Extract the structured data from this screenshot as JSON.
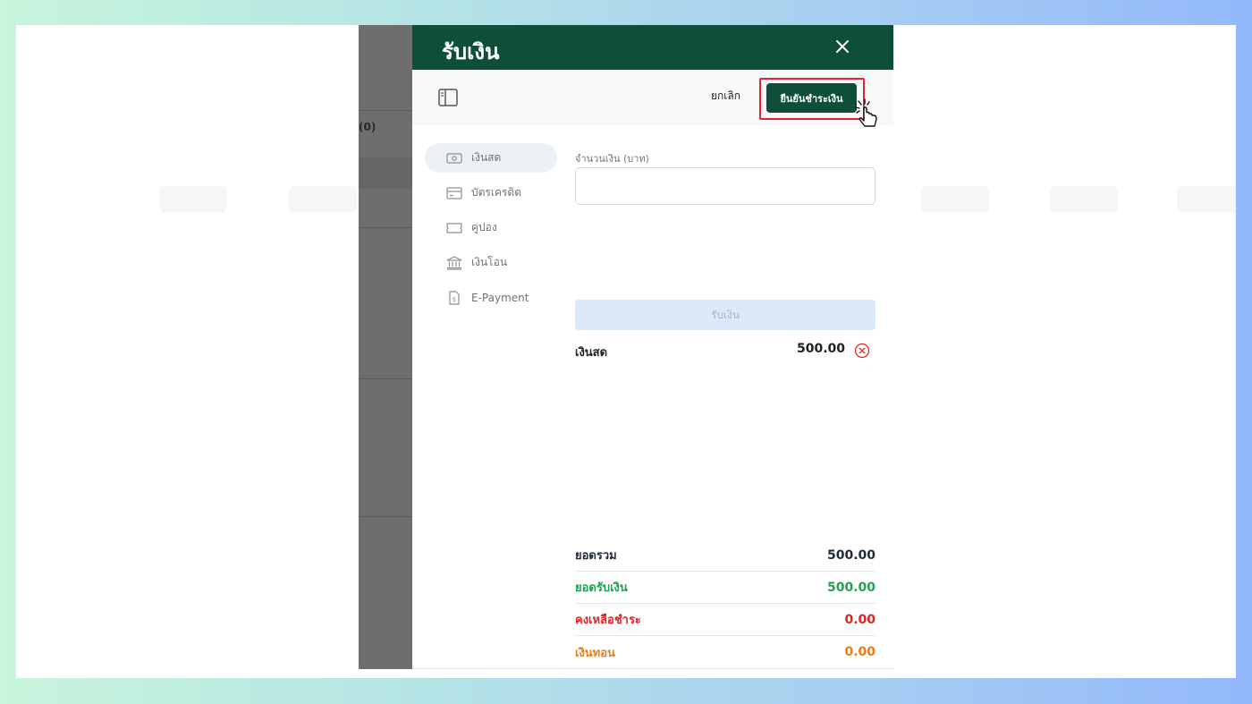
{
  "background_overlay": {
    "count_text": "(0)"
  },
  "drawer": {
    "title": "รับเงิน",
    "cancel_label": "ยกเลิก",
    "confirm_label": "ยืนยันชำระเงิน"
  },
  "payment_methods": [
    {
      "label": "เงินสด",
      "icon": "cash-icon",
      "active": true
    },
    {
      "label": "บัตรเครดิต",
      "icon": "credit-card-icon",
      "active": false
    },
    {
      "label": "คูปอง",
      "icon": "coupon-icon",
      "active": false
    },
    {
      "label": "เงินโอน",
      "icon": "bank-icon",
      "active": false
    },
    {
      "label": "E-Payment",
      "icon": "e-payment-icon",
      "active": false
    }
  ],
  "form": {
    "amount_label": "จำนวนเงิน (บาท)",
    "amount_value": "",
    "amount_placeholder": "",
    "receive_label": "รับเงิน"
  },
  "payments": [
    {
      "method": "เงินสด",
      "amount": "500.00"
    }
  ],
  "summary": {
    "total_label": "ยอดรวม",
    "total_value": "500.00",
    "received_label": "ยอดรับเงิน",
    "received_value": "500.00",
    "remaining_label": "คงเหลือชำระ",
    "remaining_value": "0.00",
    "change_label": "เงินทอน",
    "change_value": "0.00"
  },
  "colors": {
    "brand_green": "#0e4e3a",
    "highlight_red": "#e8232b",
    "received_green": "#1fa350",
    "remaining_red": "#e02424",
    "change_orange": "#f07a12"
  }
}
